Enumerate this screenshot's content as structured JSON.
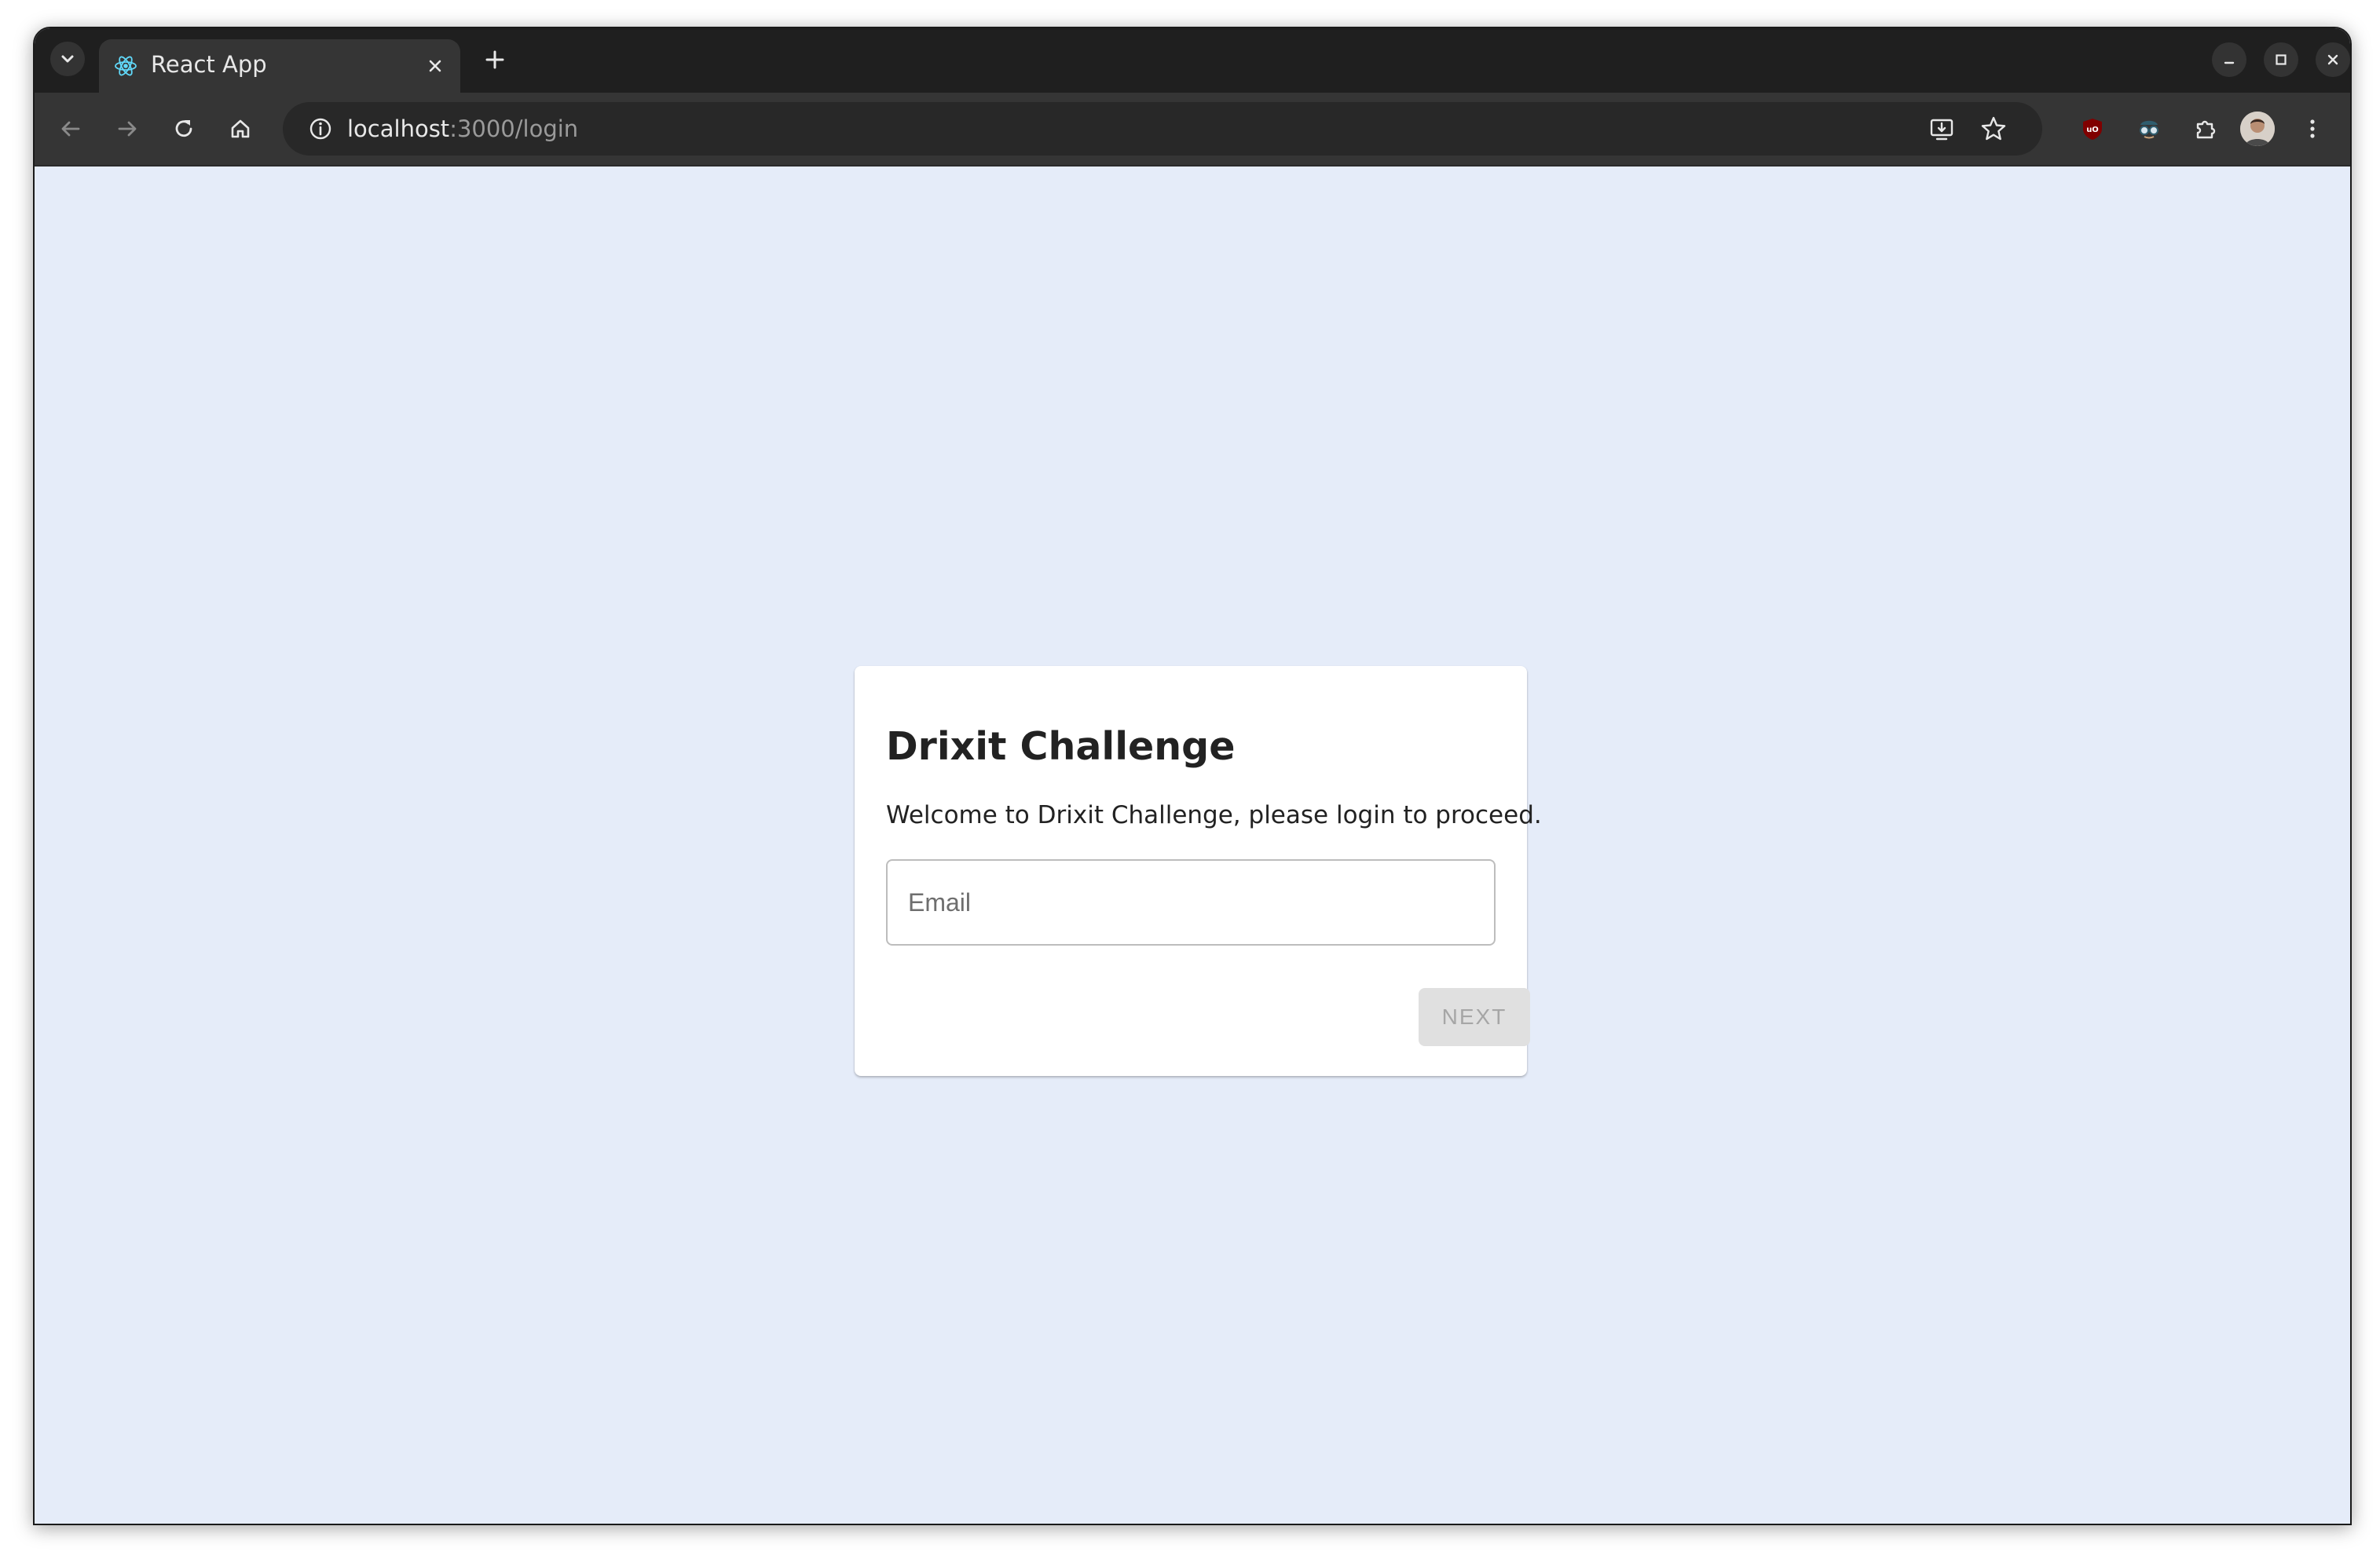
{
  "browser": {
    "tab": {
      "title": "React App",
      "favicon": "react-logo-icon"
    },
    "address_bar": {
      "host": "localhost",
      "path": ":3000/login"
    },
    "icons": {
      "tab_list": "chevron-down-icon",
      "tab_close": "close-icon",
      "new_tab": "plus-icon",
      "minimize": "minimize-icon",
      "maximize": "maximize-icon",
      "close_window": "close-icon",
      "back": "arrow-left-icon",
      "forward": "arrow-right-icon",
      "reload": "reload-icon",
      "home": "home-icon",
      "site_info": "info-icon",
      "install": "install-app-icon",
      "bookmark": "star-icon",
      "ublock": "ublock-shield-icon",
      "incognito_ext": "spy-glasses-icon",
      "extensions": "puzzle-icon",
      "profile": "avatar",
      "menu": "more-vertical-icon"
    }
  },
  "login": {
    "title": "Drixit Challenge",
    "subtitle": "Welcome to Drixit Challenge, please login to proceed.",
    "email": {
      "placeholder": "Email",
      "value": ""
    },
    "next_label": "NEXT",
    "next_disabled": true
  },
  "colors": {
    "page_background": "#e5ecf9",
    "card_background": "#ffffff",
    "button_disabled_bg": "#e0e0e0",
    "button_disabled_text": "#a6a6a6",
    "browser_chrome": "#353535"
  }
}
